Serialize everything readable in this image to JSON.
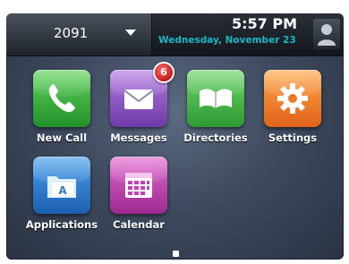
{
  "topbar": {
    "line": "2091",
    "time": "5:57 PM",
    "date": "Wednesday, November 23"
  },
  "apps": [
    {
      "label": "New Call",
      "icon": "phone-handset-icon",
      "color": "#34a83a"
    },
    {
      "label": "Messages",
      "icon": "envelope-icon",
      "color": "#8a52c4",
      "badge": "6"
    },
    {
      "label": "Directories",
      "icon": "open-book-icon",
      "color": "#3aa740"
    },
    {
      "label": "Settings",
      "icon": "gear-icon",
      "color": "#f07f2a"
    },
    {
      "label": "Applications",
      "icon": "applications-folder-icon",
      "color": "#2f7bd0"
    },
    {
      "label": "Calendar",
      "icon": "calendar-grid-icon",
      "color": "#c041b2"
    }
  ],
  "colors": {
    "date_text": "#19b7c6",
    "badge": "#d62828"
  },
  "pagination": {
    "current_page": 1,
    "total_pages": 1
  }
}
